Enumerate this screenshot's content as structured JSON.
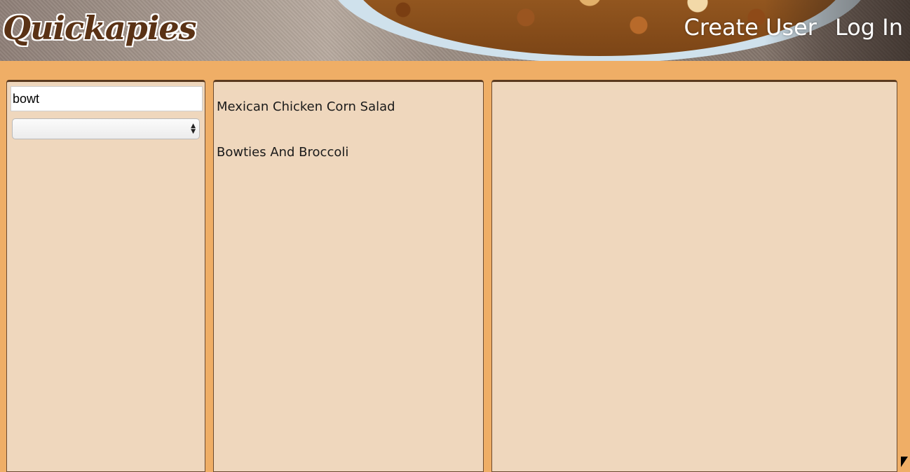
{
  "header": {
    "logo": "Quickapies",
    "nav": {
      "create_user": "Create User",
      "log_in": "Log In"
    }
  },
  "sidebar": {
    "search_value": "bowt",
    "select_value": ""
  },
  "results": [
    {
      "label": "Mexican Chicken Corn Salad"
    },
    {
      "label": "Bowties And Broccoli"
    }
  ],
  "icons": {
    "select_arrows": "updown-arrows-icon",
    "mouse_cursor": "cursor-icon"
  }
}
